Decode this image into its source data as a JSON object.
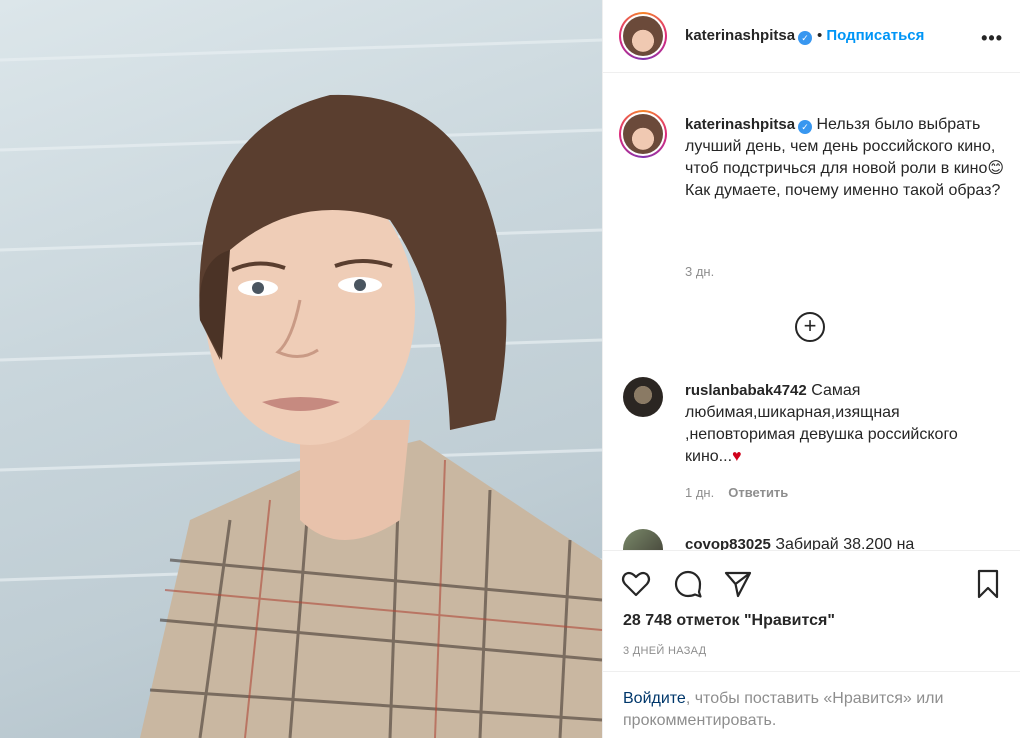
{
  "post": {
    "header": {
      "username": "katerinashpitsa",
      "dot": "•",
      "follow_label": "Подписаться",
      "more_label": "•••"
    },
    "caption": {
      "username": "katerinashpitsa",
      "text": "Нельзя было выбрать лучший день, чем день российского кино, чтоб подстричься для новой роли в кино😊 Как думаете, почему именно такой образ?",
      "time": "3 дн."
    },
    "load_more_label": "+",
    "comments": [
      {
        "username": "ruslanbabak4742",
        "text": "Самая любимая,шикарная,изящная ,неповторимая девушка российского кино...",
        "emoji": "♥",
        "time": "1 дн.",
        "reply_label": "Ответить"
      },
      {
        "username": "covop83025",
        "text": "Забирай 38.200 на",
        "emoji": "",
        "time": "",
        "reply_label": ""
      }
    ],
    "likes_text": "28 748 отметок \"Нравится\"",
    "date_text": "3 ДНЕЙ НАЗАД",
    "login": {
      "link_label": "Войдите",
      "rest_text": ", чтобы поставить «Нравится» или прокомментировать."
    },
    "icons": [
      "heart-icon",
      "comment-icon",
      "share-icon",
      "bookmark-icon",
      "verified-icon",
      "more-icon"
    ],
    "colors": {
      "link_blue": "#0095f6",
      "login_blue": "#00376b",
      "verified_blue": "#3897f0",
      "heart_red": "#d0021b",
      "gray": "#8e8e8e"
    }
  }
}
